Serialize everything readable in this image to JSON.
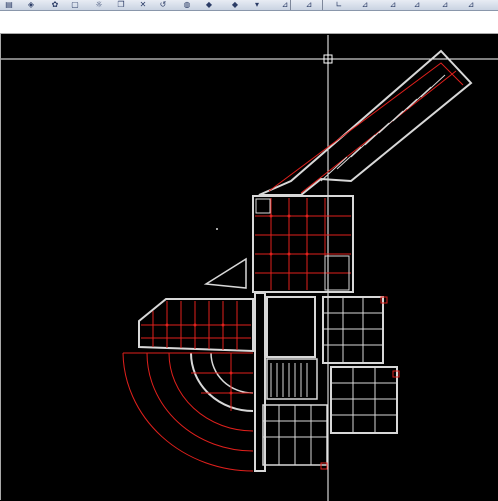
{
  "toolbar": {
    "buttons": [
      {
        "name": "layer-icon",
        "glyph": "▤"
      },
      {
        "name": "cube-icon",
        "glyph": "◈"
      },
      {
        "name": "gear-icon",
        "glyph": "✿"
      },
      {
        "name": "square-icon",
        "glyph": "▢"
      },
      {
        "name": "sun-icon",
        "glyph": "☼"
      },
      {
        "name": "copy-icon",
        "glyph": "❐"
      },
      {
        "name": "erase-icon",
        "glyph": "✕"
      },
      {
        "name": "rotate-icon",
        "glyph": "↺"
      },
      {
        "name": "bulb-icon",
        "glyph": "◍"
      },
      {
        "name": "stack-icon",
        "glyph": "◆"
      },
      {
        "name": "layers-icon",
        "glyph": "◆"
      },
      {
        "name": "dropdown-icon",
        "glyph": "▾"
      },
      {
        "name": "dimension-linear-icon",
        "glyph": "⊿"
      },
      {
        "name": "dimension-aligned-icon",
        "glyph": "⊿"
      },
      {
        "name": "dimension-angular-icon",
        "glyph": "∟"
      },
      {
        "name": "dimension-radius-icon",
        "glyph": "⊿"
      },
      {
        "name": "dimension-diameter-icon",
        "glyph": "⊿"
      },
      {
        "name": "dimension-ordinate-icon",
        "glyph": "⊿"
      },
      {
        "name": "dimension-baseline-icon",
        "glyph": "⊿"
      },
      {
        "name": "dimension-continue-icon",
        "glyph": "⊿"
      }
    ]
  },
  "drawing": {
    "crosshair_color": "#ffffff",
    "wall_color": "#d8d8d8",
    "grid_color": "#e0201c",
    "background_color": "#000000"
  }
}
